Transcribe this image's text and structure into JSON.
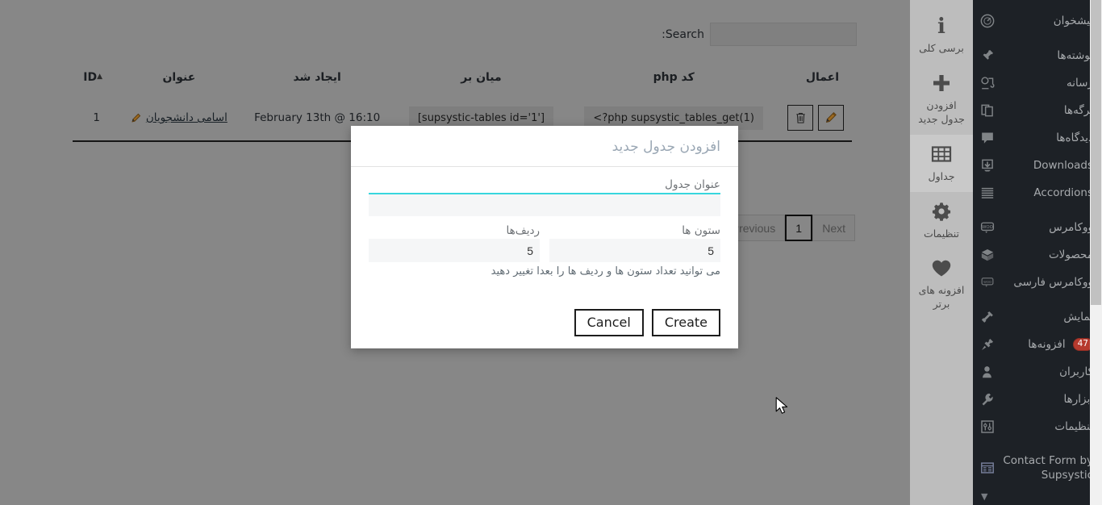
{
  "wp_menu": {
    "items": [
      {
        "label": "پیشخوان",
        "icon": "dashboard-icon",
        "badge": null,
        "gap_after": true
      },
      {
        "label": "نوشته‌ها",
        "icon": "pin-icon",
        "badge": null,
        "gap_after": false
      },
      {
        "label": "رسانه",
        "icon": "media-icon",
        "badge": null,
        "gap_after": false
      },
      {
        "label": "برگه‌ها",
        "icon": "pages-icon",
        "badge": null,
        "gap_after": false
      },
      {
        "label": "دیدگاه‌ها",
        "icon": "comments-icon",
        "badge": null,
        "gap_after": false
      },
      {
        "label": "Downloads",
        "icon": "downloads-icon",
        "badge": null,
        "gap_after": false
      },
      {
        "label": "Accordions",
        "icon": "accordions-icon",
        "badge": null,
        "gap_after": true
      },
      {
        "label": "ووکامرس",
        "icon": "woocommerce-icon",
        "badge": null,
        "gap_after": false
      },
      {
        "label": "محصولات",
        "icon": "products-icon",
        "badge": null,
        "gap_after": false
      },
      {
        "label": "ووکامرس فارسی",
        "icon": "woocommerce-fa-icon",
        "badge": null,
        "gap_after": true
      },
      {
        "label": "نمایش",
        "icon": "appearance-icon",
        "badge": null,
        "gap_after": false
      },
      {
        "label": "افزونه‌ها",
        "icon": "plugins-icon",
        "badge": "47",
        "gap_after": false
      },
      {
        "label": "کاربران",
        "icon": "users-icon",
        "badge": null,
        "gap_after": false
      },
      {
        "label": "ابزارها",
        "icon": "tools-icon",
        "badge": null,
        "gap_after": false
      },
      {
        "label": "تنظیمات",
        "icon": "settings-icon",
        "badge": null,
        "gap_after": true
      },
      {
        "label": "Contact Form by Supsystic",
        "icon": "contact-form-icon",
        "badge": null,
        "gap_after": false
      }
    ],
    "collapse_label": "▼"
  },
  "plugin_nav": {
    "items": [
      {
        "label": "برسی کلی",
        "icon": "info-icon",
        "active": false
      },
      {
        "label": "افزودن جدول جدید",
        "icon": "plus-icon",
        "active": false
      },
      {
        "label": "جداول",
        "icon": "table-grid-icon",
        "active": true
      },
      {
        "label": "تنظیمات",
        "icon": "gear-icon",
        "active": false
      },
      {
        "label": "افزونه های برتر",
        "icon": "heart-icon",
        "active": false
      }
    ]
  },
  "search": {
    "label": "Search:",
    "value": "",
    "placeholder": ""
  },
  "table": {
    "columns": [
      {
        "key": "id",
        "label": "ID",
        "sorted": true,
        "sort_arrow": "▲"
      },
      {
        "key": "title",
        "label": "عنوان",
        "sorted": false,
        "sort_arrow": ""
      },
      {
        "key": "created",
        "label": "ایجاد شد",
        "sorted": false,
        "sort_arrow": ""
      },
      {
        "key": "shortcode",
        "label": "میان بر",
        "sorted": false,
        "sort_arrow": ""
      },
      {
        "key": "php",
        "label": "کد php",
        "sorted": false,
        "sort_arrow": ""
      },
      {
        "key": "actions",
        "label": "اعمال",
        "sorted": false,
        "sort_arrow": ""
      }
    ],
    "rows": [
      {
        "id": "1",
        "title": "اسامی دانشجویان",
        "created": "February 13th @ 16:10",
        "shortcode": "[supsystic-tables id='1']",
        "php": "<?php supsystic_tables_get(1)",
        "actions": [
          "edit-button",
          "delete-button"
        ]
      }
    ]
  },
  "pagination": {
    "previous_label": "Previous",
    "next_label": "Next",
    "pages": [
      "1"
    ],
    "current_page": "1"
  },
  "modal": {
    "title": "افزودن جدول جدید",
    "fields": {
      "title_label": "عنوان جدول",
      "title_value": "",
      "title_placeholder": "",
      "rows_label": "ردیف‌ها",
      "rows_value": "5",
      "cols_label": "ستون ها",
      "cols_value": "5"
    },
    "hint": "می توانید تعداد ستون ها و ردیف ها را بعدا تغییر دهید",
    "create_label": "Create",
    "cancel_label": "Cancel"
  },
  "colors": {
    "wp_menu_bg": "#1d2126",
    "wp_menu_text": "#a7aaad",
    "badge_bg": "#b63a2e",
    "plugin_nav_bg": "#bdbdbd",
    "plugin_nav_active_bg": "#c9c9c9",
    "content_bg": "#bdbdbd",
    "modal_bg": "#ffffff",
    "modal_title_text": "#9aa7b4",
    "field_accent": "#37d6de",
    "field_bg": "#f5f6f7",
    "button_border": "#1d1d1d"
  }
}
